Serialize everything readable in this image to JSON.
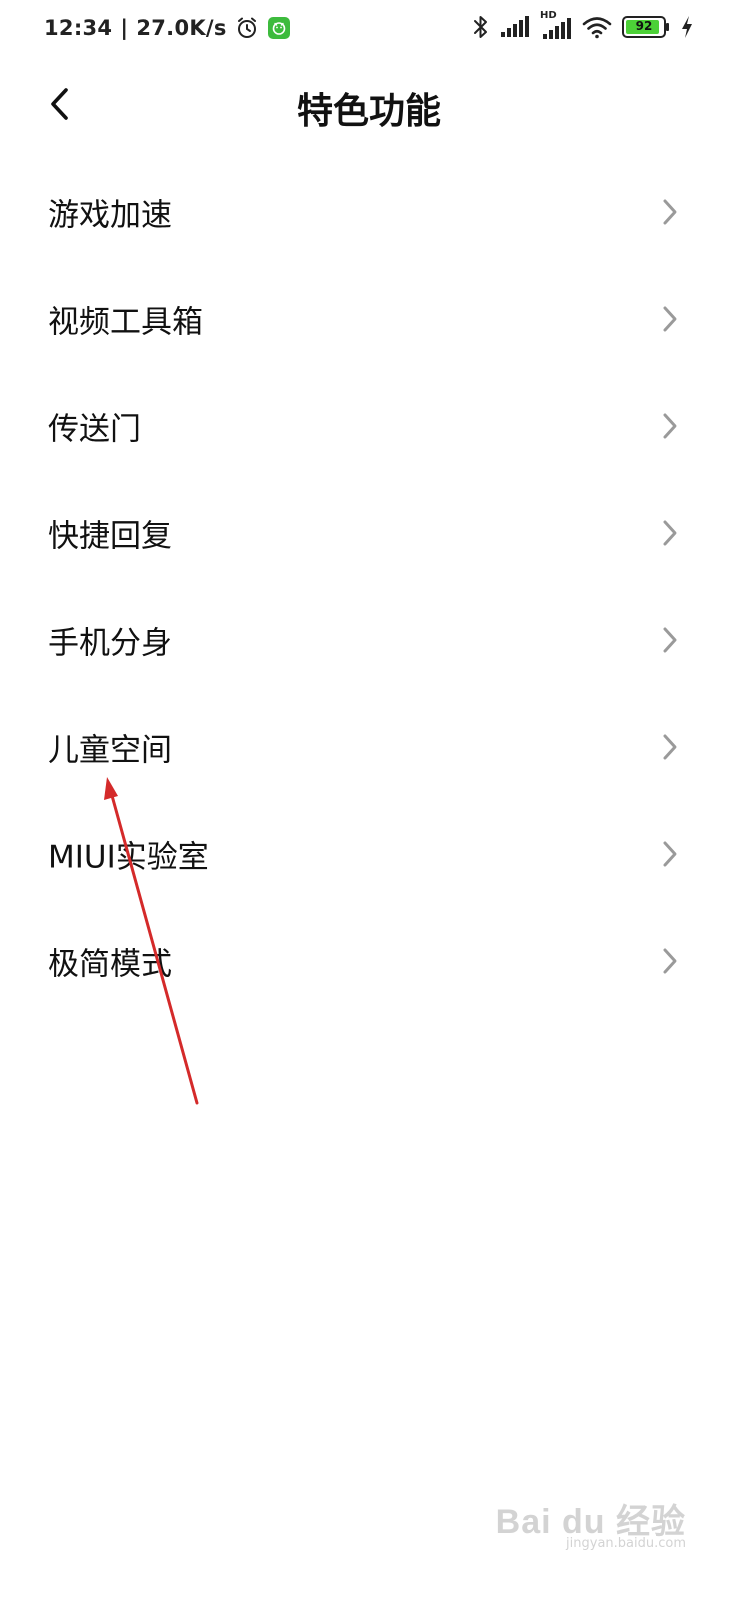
{
  "status_bar": {
    "time": "12:34",
    "separator": "|",
    "network_speed": "27.0K/s",
    "battery_level": "92",
    "icons": [
      "alarm-icon",
      "app-notification-icon",
      "bluetooth-icon",
      "signal-icon",
      "hd-signal-icon",
      "wifi-icon",
      "battery-icon",
      "charging-icon"
    ],
    "hd_label": "HD"
  },
  "header": {
    "title": "特色功能",
    "back_icon": "chevron-left-icon"
  },
  "menu": {
    "items": [
      {
        "label": "游戏加速"
      },
      {
        "label": "视频工具箱"
      },
      {
        "label": "传送门"
      },
      {
        "label": "快捷回复"
      },
      {
        "label": "手机分身"
      },
      {
        "label": "儿童空间"
      },
      {
        "label": "MIUI实验室"
      },
      {
        "label": "极简模式"
      }
    ]
  },
  "annotation": {
    "type": "arrow",
    "color": "#d42a2a",
    "target": "儿童空间"
  },
  "watermark": {
    "main": "Bai du 经验",
    "sub": "jingyan.baidu.com"
  },
  "colors": {
    "battery_fill": "#4cd137",
    "app_icon_green": "#3dbb3d",
    "chevron": "#9a9a9a"
  }
}
